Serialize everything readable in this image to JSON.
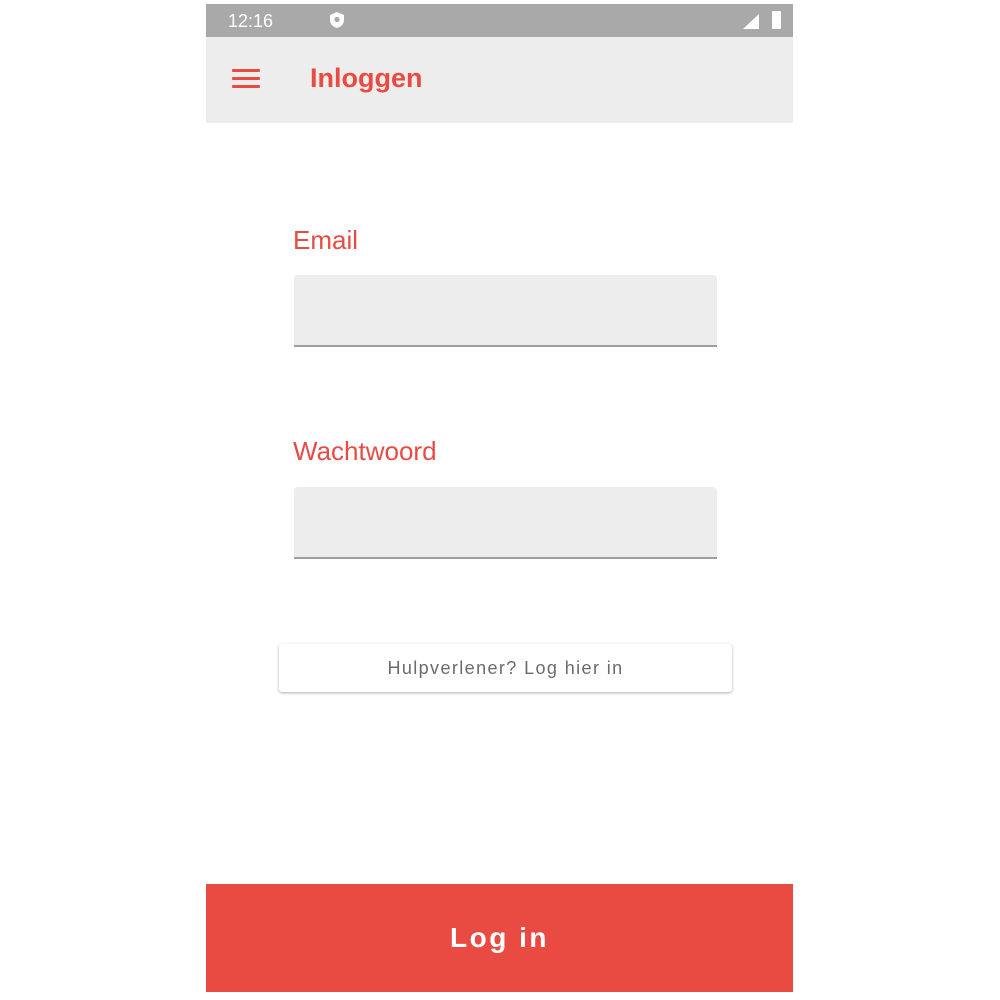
{
  "status_bar": {
    "time": "12:16",
    "icons": [
      "shield-icon",
      "signal-icon",
      "battery-icon"
    ]
  },
  "app_bar": {
    "menu_icon": "hamburger-menu-icon",
    "title": "Inloggen"
  },
  "form": {
    "email": {
      "label": "Email",
      "value": "",
      "placeholder": ""
    },
    "password": {
      "label": "Wachtwoord",
      "value": "",
      "placeholder": ""
    },
    "helper_button_label": "Hulpverlener? Log hier in",
    "login_button_label": "Log in"
  },
  "colors": {
    "accent": "#e94b43",
    "app_bar_background": "#ededed",
    "status_bar_background": "#a9a9a9",
    "input_background": "#ededed"
  }
}
